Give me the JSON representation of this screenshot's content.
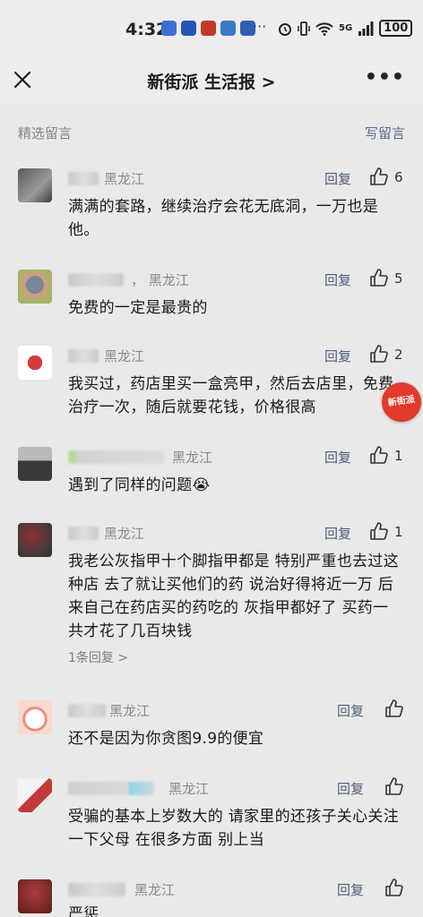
{
  "status_bar": {
    "time": "4:32",
    "more": "···",
    "network": "5G",
    "battery": "100"
  },
  "nav": {
    "title": "新街派 生活报 >"
  },
  "section": {
    "title": "精选留言",
    "write_label": "写留言"
  },
  "comments": [
    {
      "location": "黑龙江",
      "reply_label": "回复",
      "likes": "6",
      "text": "满满的套路，继续治疗会花无底洞，一万也是他。"
    },
    {
      "location": "，  黑龙江",
      "reply_label": "回复",
      "likes": "5",
      "text": "免费的一定是最贵的"
    },
    {
      "location": "黑龙江",
      "reply_label": "回复",
      "likes": "2",
      "text": "我买过，药店里买一盒亮甲，然后去店里，免费治疗一次，随后就要花钱，价格很高"
    },
    {
      "location": "黑龙江",
      "reply_label": "回复",
      "likes": "1",
      "text": "遇到了同样的问题😭"
    },
    {
      "location": "黑龙江",
      "reply_label": "回复",
      "likes": "1",
      "text": "我老公灰指甲十个脚指甲都是 特别严重也去过这种店 去了就让买他们的药 说治好得将近一万  后来自己在药店买的药吃的 灰指甲都好了 买药一共才花了几百块钱",
      "sub_replies": "1条回复 >"
    },
    {
      "location": "黑龙江",
      "reply_label": "回复",
      "likes": "",
      "text": "还不是因为你贪图9.9的便宜"
    },
    {
      "location": "黑龙江",
      "reply_label": "回复",
      "likes": "",
      "text": "受骗的基本上岁数大的 请家里的还孩子关心关注一下父母 在很多方面  别上当"
    },
    {
      "location": "黑龙江",
      "reply_label": "回复",
      "likes": "",
      "text": "严惩"
    }
  ],
  "watermark": "新街派",
  "colors": {
    "background": "#e9e9e9",
    "link_blue": "#556b91",
    "watermark_red": "#e23a2c"
  }
}
